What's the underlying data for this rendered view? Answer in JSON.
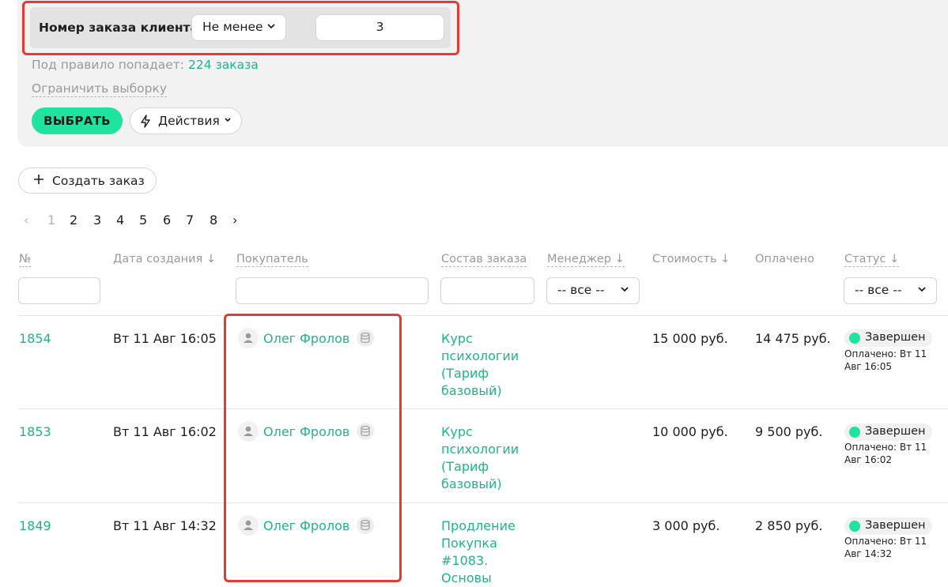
{
  "rule": {
    "field_label": "Номер заказа клиента",
    "operator": "Не менее",
    "value": "3",
    "match_prefix": "Под правило попадает:",
    "match_count": "224 заказа",
    "limit_link": "Ограничить выборку",
    "select_button": "ВЫБРАТЬ",
    "actions_button": "Действия"
  },
  "create_order_button": "Создать заказ",
  "pagination": {
    "prev": "‹",
    "current": "1",
    "pages": [
      "2",
      "3",
      "4",
      "5",
      "6",
      "7",
      "8"
    ],
    "next": "›"
  },
  "columns": {
    "num": "№",
    "created": "Дата создания ↓",
    "buyer": "Покупатель",
    "items": "Состав заказа",
    "manager": "Менеджер ↓",
    "cost": "Стоимость ↓",
    "paid": "Оплачено",
    "status": "Статус ↓"
  },
  "filters": {
    "manager": "-- все --",
    "status": "-- все --"
  },
  "orders": [
    {
      "num": "1854",
      "created": "Вт 11 Авг 16:05",
      "buyer": "Олег Фролов",
      "items": "Курс психологии (Тариф базовый)",
      "cost": "15 000 руб.",
      "paid": "14 475 руб.",
      "status": "Завершен",
      "status_note": "Оплачено: Вт 11 Авг 16:05"
    },
    {
      "num": "1853",
      "created": "Вт 11 Авг 16:02",
      "buyer": "Олег Фролов",
      "items": "Курс психологии (Тариф базовый)",
      "cost": "10 000 руб.",
      "paid": "9 500 руб.",
      "status": "Завершен",
      "status_note": "Оплачено: Вт 11 Авг 16:02"
    },
    {
      "num": "1849",
      "created": "Вт 11 Авг 14:32",
      "buyer": "Олег Фролов",
      "items": "Продление Покупка #1083. Основы",
      "cost": "3 000 руб.",
      "paid": "2 850 руб.",
      "status": "Завершен",
      "status_note": "Оплачено: Вт 11 Авг 14:32"
    }
  ],
  "colors": {
    "accent_green": "#1fb58a",
    "button_green": "#20e3a0",
    "highlight_red": "#e53935"
  },
  "icons": [
    "chevron-down-icon",
    "lightning-icon",
    "plus-icon",
    "chevron-left-icon",
    "chevron-right-icon",
    "user-icon",
    "database-icon",
    "status-dot-icon"
  ]
}
